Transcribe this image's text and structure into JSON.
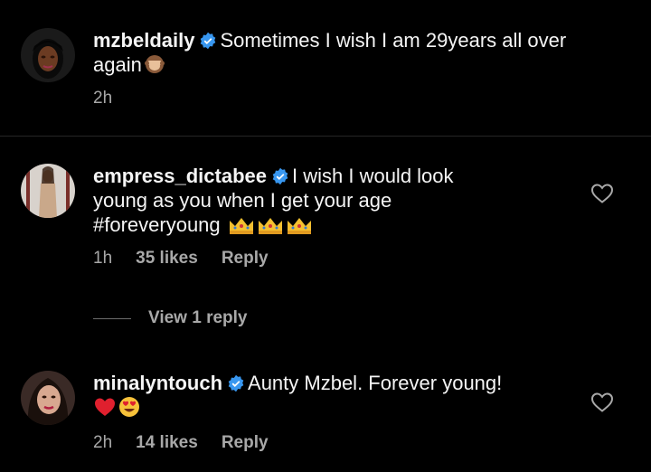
{
  "caption": {
    "username": "mzbeldaily",
    "text": "Sometimes I wish I am 29years all over again",
    "emoji": "see-no-evil-monkey",
    "time": "2h"
  },
  "comments": [
    {
      "username": "empress_dictabee",
      "text_line1": "I wish I would look",
      "text_line2": "young as you when I get your age",
      "text_line3": "#foreveryoung",
      "emoji": "crown",
      "time": "1h",
      "likes": "35 likes",
      "reply": "Reply",
      "view_replies": "View 1 reply"
    },
    {
      "username": "minalyntouch",
      "text": "Aunty Mzbel. Forever young!",
      "emoji": [
        "red-heart",
        "heart-eyes-face"
      ],
      "time": "2h",
      "likes": "14 likes",
      "reply": "Reply"
    }
  ],
  "colors": {
    "background": "#000000",
    "text": "#f5f5f5",
    "meta": "#a8a8a8",
    "verified": "#3897f0",
    "divider": "#262626"
  }
}
